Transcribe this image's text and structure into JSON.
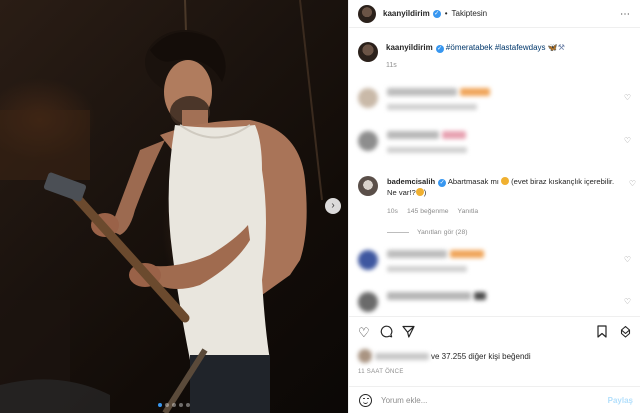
{
  "post_header": {
    "username": "kaanyildirim",
    "separator": "•",
    "follow_status": "Takiptesin"
  },
  "caption": {
    "username": "kaanyildirim",
    "hashtags": [
      "#ömeratabek",
      "#lastafewdays"
    ],
    "time": "11s"
  },
  "featured_comment": {
    "username": "bademcisalih",
    "text": "Abartmasak mı",
    "text2": "(evet biraz kıskançlık içerebilir. Ne var!?",
    "close": ")",
    "time": "10s",
    "likes": "145 beğenme",
    "reply": "Yanıtla"
  },
  "view_replies": "Yanıtları gör (28)",
  "likes_summary": {
    "suffix": "ve 37.255 diğer kişi beğendi"
  },
  "timestamp": "11 SAAT ÖNCE",
  "add_comment": {
    "placeholder": "Yorum ekle...",
    "post_label": "Paylaş"
  },
  "colors": {
    "link": "#00376b",
    "verified": "#3897f0",
    "muted": "#8e8e8e",
    "post_button": "#b2dffc"
  },
  "icons": [
    "heart-icon",
    "comment-icon",
    "share-icon",
    "bookmark-icon",
    "emoji-icon",
    "more-options-icon",
    "next-arrow-icon"
  ]
}
